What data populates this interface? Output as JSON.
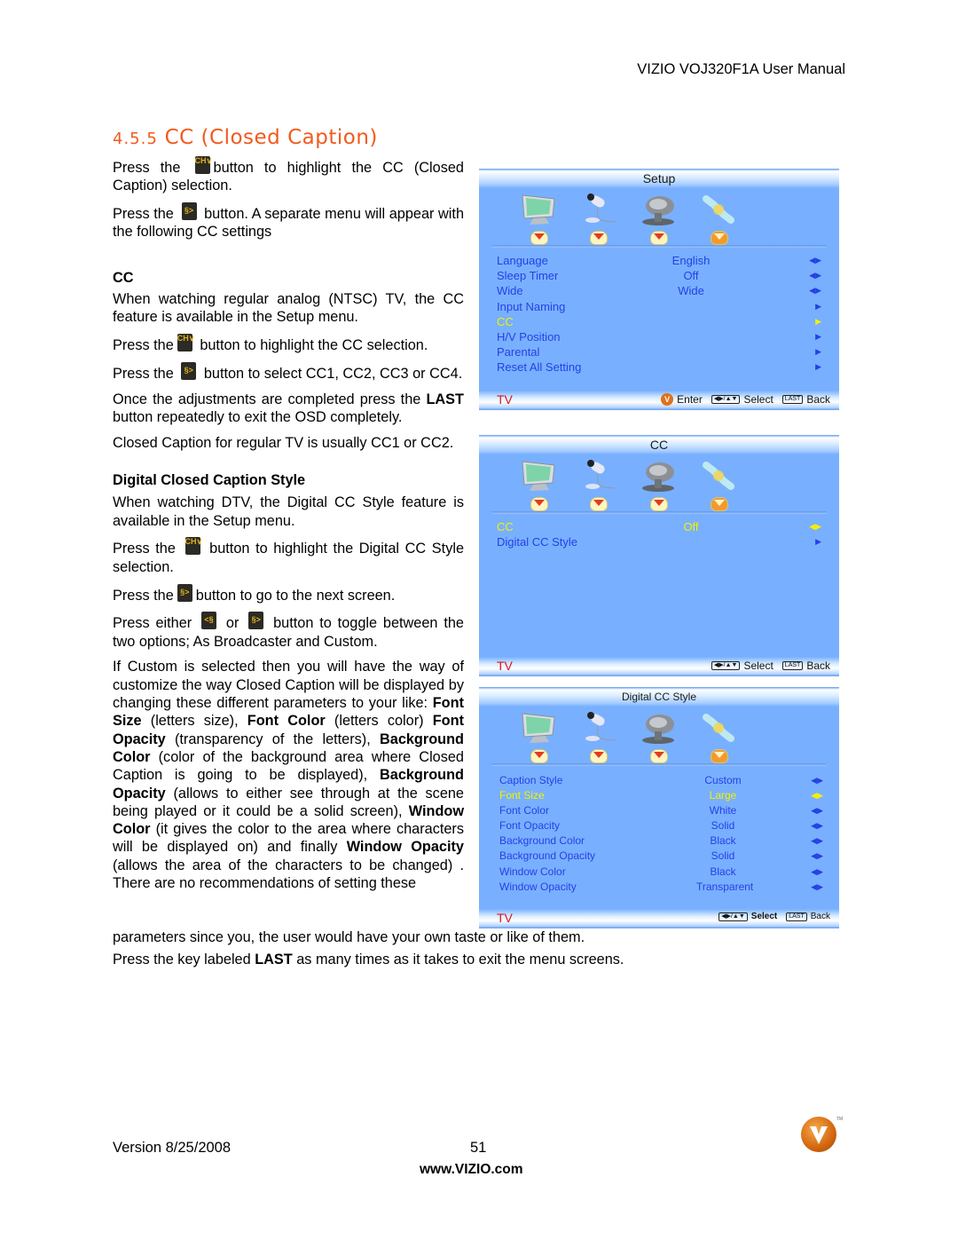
{
  "header": {
    "manual_title": "VIZIO VOJ320F1A User Manual"
  },
  "section": {
    "number": "4.5.5",
    "title": "CC (Closed Caption)"
  },
  "body": {
    "p1_pre": "Press the",
    "p1_post": "button to highlight the CC (Closed Caption) selection.",
    "p2_pre": "Press the",
    "p2_post": "button. A separate menu will appear with the following CC settings",
    "cc_heading": "CC",
    "p3": "When watching regular analog (NTSC) TV, the CC feature is available in the Setup menu.",
    "p4_pre": "Press the",
    "p4_post": "button to highlight the CC selection.",
    "p5_pre": "Press the",
    "p5_post": "button to select CC1, CC2, CC3 or CC4.",
    "p6_pre": "Once the adjustments are completed press the",
    "p6_bold": "LAST",
    "p6_post": "button repeatedly to exit the OSD completely.",
    "p7": "Closed Caption for regular TV is usually CC1 or CC2.",
    "dcc_heading": "Digital Closed Caption Style",
    "p8": "When watching DTV, the Digital CC Style feature is available in the Setup menu.",
    "p9_pre": "Press the",
    "p9_post": "button to highlight the Digital CC Style selection.",
    "p10_pre": "Press the",
    "p10_post": "button to go to the next screen.",
    "p11_pre": "Press either",
    "p11_mid": "or",
    "p11_post": "button to toggle between the two options; As Broadcaster and Custom.",
    "p12": {
      "t1": "If Custom is selected then you will have the way of customize the way Closed Caption will be displayed by changing these different parameters to your like: ",
      "b1": "Font Size",
      "t2": " (letters size), ",
      "b2": "Font Color",
      "t3": " (letters color) ",
      "b3": "Font Opacity",
      "t4": " (transparency of the letters), ",
      "b4": "Background Color",
      "t5": " (color of the background area where Closed Caption is going to be displayed), ",
      "b5": "Background Opacity",
      "t6": " (allows to either see through at the scene being played or it could be a solid screen), ",
      "b6": "Window Color",
      "t7": " (it gives the color to the area where characters will be displayed on) and finally ",
      "b7": "Window Opacity",
      "t8": " (allows the area of the characters to be changed) . There are no recommendations of setting these"
    },
    "p12_cont": "parameters since you, the user would have your own taste or like of them.",
    "p13_pre": "Press the key labeled",
    "p13_bold": "LAST",
    "p13_post": "as many times as it takes to exit the menu screens.",
    "icons": {
      "ch_down": "CH∨",
      "right_arrow": "§>",
      "left_arrow": "<§"
    }
  },
  "osd_setup": {
    "title": "Setup",
    "rows": [
      {
        "label": "Language",
        "value": "English",
        "arrow": "◀▶"
      },
      {
        "label": "Sleep Timer",
        "value": "Off",
        "arrow": "◀▶"
      },
      {
        "label": "Wide",
        "value": "Wide",
        "arrow": "◀▶"
      },
      {
        "label": "Input Naming",
        "value": "",
        "arrow": "▶"
      },
      {
        "label": "CC",
        "value": "",
        "arrow": "▶",
        "highlighted": true
      },
      {
        "label": "H/V Position",
        "value": "",
        "arrow": "▶"
      },
      {
        "label": "Parental",
        "value": "",
        "arrow": "▶"
      },
      {
        "label": "Reset All Setting",
        "value": "",
        "arrow": "▶"
      }
    ],
    "footer": {
      "source": "TV",
      "enter": "Enter",
      "select": "Select",
      "back": "Back",
      "last_key": "LAST",
      "nav_key": "◀▶/▲▼"
    }
  },
  "osd_cc": {
    "title": "CC",
    "rows": [
      {
        "label": "CC",
        "value": "Off",
        "arrow": "◀▶",
        "highlighted": true
      },
      {
        "label": "Digital CC Style",
        "value": "",
        "arrow": "▶"
      }
    ],
    "footer": {
      "source": "TV",
      "select": "Select",
      "back": "Back",
      "last_key": "LAST",
      "nav_key": "◀▶/▲▼"
    }
  },
  "osd_dcc": {
    "title": "Digital CC Style",
    "rows": [
      {
        "label": "Caption Style",
        "value": "Custom",
        "arrow": "◀▶"
      },
      {
        "label": "Font Size",
        "value": "Large",
        "arrow": "◀▶",
        "highlighted": true
      },
      {
        "label": "Font Color",
        "value": "White",
        "arrow": "◀▶"
      },
      {
        "label": "Font Opacity",
        "value": "Solid",
        "arrow": "◀▶"
      },
      {
        "label": "Background Color",
        "value": "Black",
        "arrow": "◀▶"
      },
      {
        "label": "Background Opacity",
        "value": "Solid",
        "arrow": "◀▶"
      },
      {
        "label": "Window Color",
        "value": "Black",
        "arrow": "◀▶"
      },
      {
        "label": "Window Opacity",
        "value": "Transparent",
        "arrow": "◀▶"
      }
    ],
    "footer": {
      "source": "TV",
      "select": "Select",
      "back": "Back",
      "last_key": "LAST",
      "nav_key": "◀▶/▲▼"
    }
  },
  "osd_category_icons": [
    "tv-picture-icon",
    "microphone-audio-icon",
    "satellite-dish-icon",
    "wrench-setup-icon"
  ],
  "footer": {
    "version": "Version 8/25/2008",
    "page_number": "51",
    "url": "www.VIZIO.com"
  },
  "colors": {
    "accent_title": "#f25a1c",
    "osd_bg": "#78b0ff",
    "osd_text": "#2540e6",
    "osd_highlight": "#f4f000",
    "osd_source": "#e0141e"
  }
}
